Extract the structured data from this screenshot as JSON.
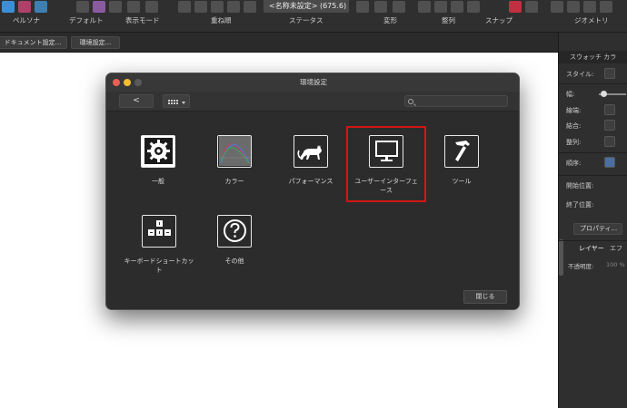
{
  "toolbar": {
    "document_title": "<名称未設定> (675.6)",
    "labels": {
      "persona": "ペルソナ",
      "default": "デフォルト",
      "view_mode": "表示モード",
      "stacking": "重ね順",
      "status": "ステータス",
      "transform": "変形",
      "arrange": "整列",
      "snap": "スナップ",
      "geometry": "ジオメトリ"
    }
  },
  "subbar": {
    "document_settings": "ドキュメント設定...",
    "preferences": "環境設定..."
  },
  "right_panel": {
    "tabs": "スウォッチ カラ",
    "style_label": "スタイル:",
    "width_label": "幅:",
    "line_end_label": "線端:",
    "join_label": "結合:",
    "align_label": "整列:",
    "order_label": "順序:",
    "start_arrow_label": "開始位置:",
    "end_arrow_label": "終了位置:",
    "properties_button": "プロパティ...",
    "layers_tab": "レイヤー",
    "effects_tab": "エフ",
    "opacity_label": "不透明度:",
    "opacity_value": "100 %"
  },
  "dialog": {
    "title": "環境設定",
    "back_label": "<",
    "search_placeholder": "",
    "items": [
      {
        "label": "一般",
        "icon": "gear-icon"
      },
      {
        "label": "カラー",
        "icon": "color-icon"
      },
      {
        "label": "パフォーマンス",
        "icon": "cat-icon"
      },
      {
        "label": "ユーザーインターフェース",
        "icon": "monitor-icon"
      },
      {
        "label": "ツール",
        "icon": "hammer-icon"
      },
      {
        "label": "キーボードショートカット",
        "icon": "keyboard-icon"
      },
      {
        "label": "その他",
        "icon": "question-icon"
      }
    ],
    "close_label": "閉じる"
  },
  "colors": {
    "highlight": "#d41414",
    "traffic_red": "#ee5e57",
    "traffic_yellow": "#f5bd2e",
    "traffic_gray": "#5a5a5a"
  }
}
